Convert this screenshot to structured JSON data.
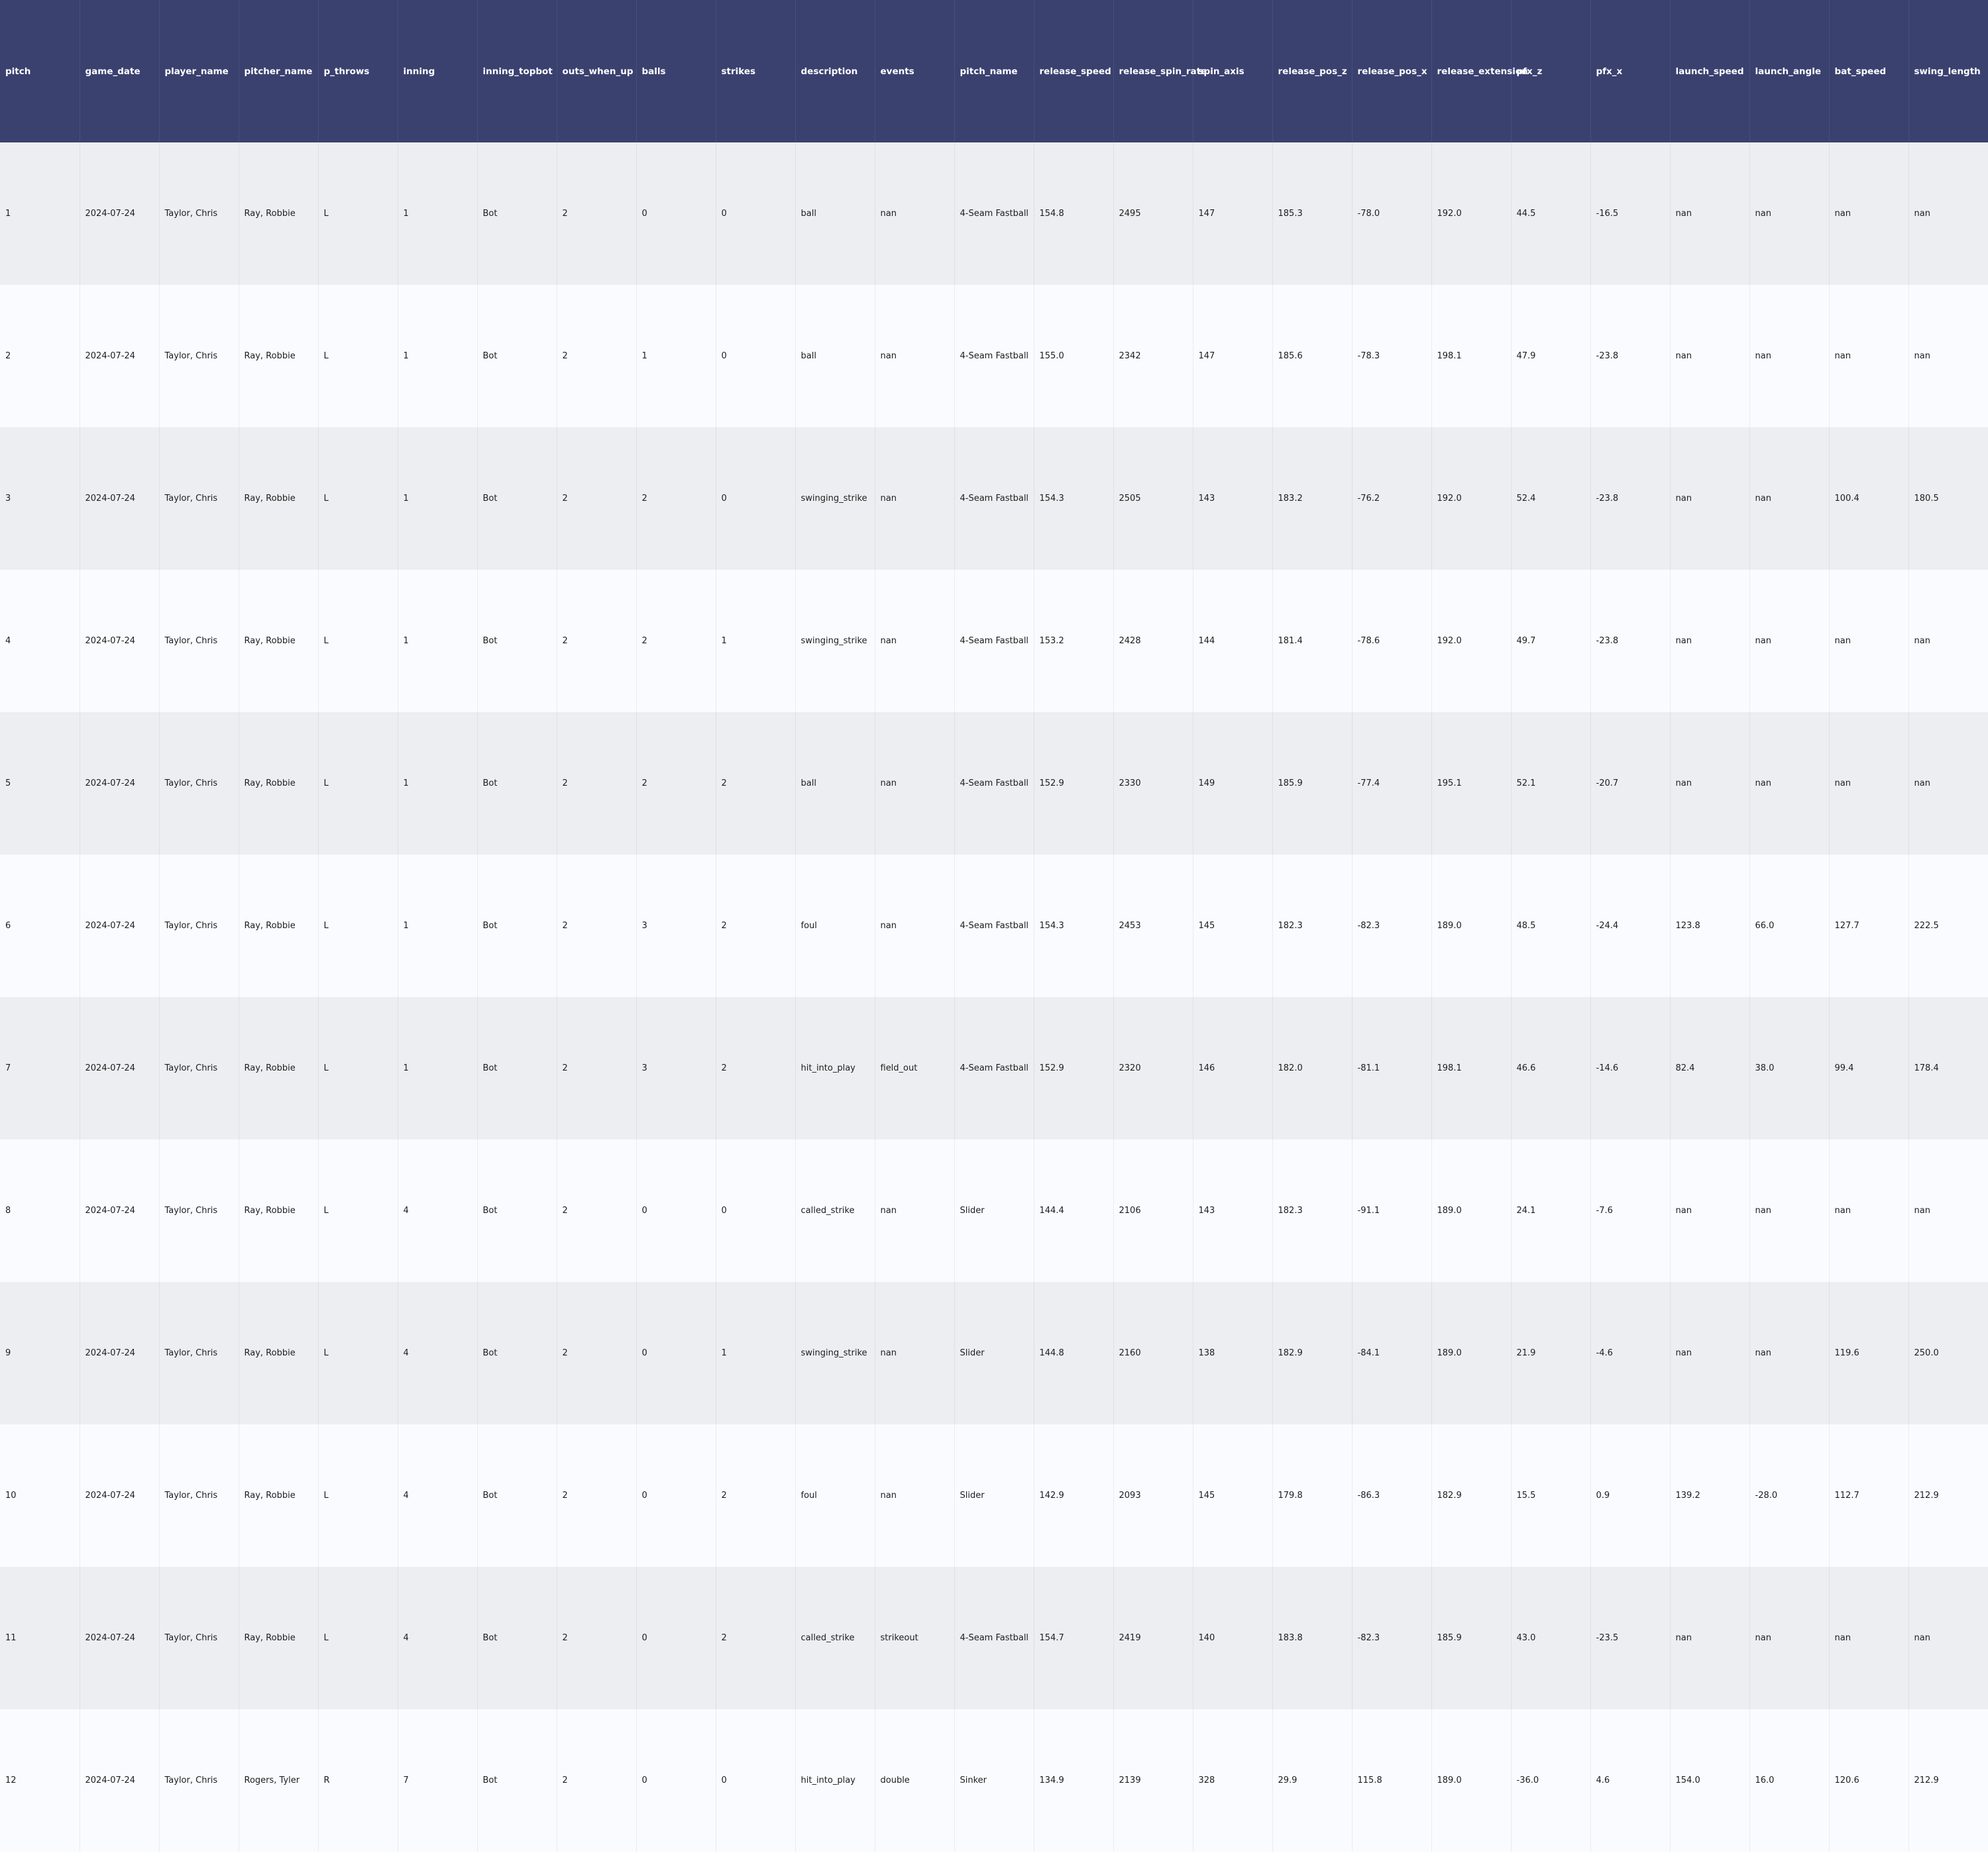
{
  "chart_data": {
    "type": "table",
    "columns": [
      "pitch",
      "game_date",
      "player_name",
      "pitcher_name",
      "p_throws",
      "inning",
      "inning_topbot",
      "outs_when_up",
      "balls",
      "strikes",
      "description",
      "events",
      "pitch_name",
      "release_speed",
      "release_spin_rate",
      "spin_axis",
      "release_pos_z",
      "release_pos_x",
      "release_extension",
      "pfx_z",
      "pfx_x",
      "launch_speed",
      "launch_angle",
      "bat_speed",
      "swing_length"
    ],
    "rows": [
      [
        "1",
        "2024-07-24",
        "Taylor, Chris",
        "Ray, Robbie",
        "L",
        "1",
        "Bot",
        "2",
        "0",
        "0",
        "ball",
        "nan",
        "4-Seam Fastball",
        "154.8",
        "2495",
        "147",
        "185.3",
        "-78.0",
        "192.0",
        "44.5",
        "-16.5",
        "nan",
        "nan",
        "nan",
        "nan"
      ],
      [
        "2",
        "2024-07-24",
        "Taylor, Chris",
        "Ray, Robbie",
        "L",
        "1",
        "Bot",
        "2",
        "1",
        "0",
        "ball",
        "nan",
        "4-Seam Fastball",
        "155.0",
        "2342",
        "147",
        "185.6",
        "-78.3",
        "198.1",
        "47.9",
        "-23.8",
        "nan",
        "nan",
        "nan",
        "nan"
      ],
      [
        "3",
        "2024-07-24",
        "Taylor, Chris",
        "Ray, Robbie",
        "L",
        "1",
        "Bot",
        "2",
        "2",
        "0",
        "swinging_strike",
        "nan",
        "4-Seam Fastball",
        "154.3",
        "2505",
        "143",
        "183.2",
        "-76.2",
        "192.0",
        "52.4",
        "-23.8",
        "nan",
        "nan",
        "100.4",
        "180.5"
      ],
      [
        "4",
        "2024-07-24",
        "Taylor, Chris",
        "Ray, Robbie",
        "L",
        "1",
        "Bot",
        "2",
        "2",
        "1",
        "swinging_strike",
        "nan",
        "4-Seam Fastball",
        "153.2",
        "2428",
        "144",
        "181.4",
        "-78.6",
        "192.0",
        "49.7",
        "-23.8",
        "nan",
        "nan",
        "nan",
        "nan"
      ],
      [
        "5",
        "2024-07-24",
        "Taylor, Chris",
        "Ray, Robbie",
        "L",
        "1",
        "Bot",
        "2",
        "2",
        "2",
        "ball",
        "nan",
        "4-Seam Fastball",
        "152.9",
        "2330",
        "149",
        "185.9",
        "-77.4",
        "195.1",
        "52.1",
        "-20.7",
        "nan",
        "nan",
        "nan",
        "nan"
      ],
      [
        "6",
        "2024-07-24",
        "Taylor, Chris",
        "Ray, Robbie",
        "L",
        "1",
        "Bot",
        "2",
        "3",
        "2",
        "foul",
        "nan",
        "4-Seam Fastball",
        "154.3",
        "2453",
        "145",
        "182.3",
        "-82.3",
        "189.0",
        "48.5",
        "-24.4",
        "123.8",
        "66.0",
        "127.7",
        "222.5"
      ],
      [
        "7",
        "2024-07-24",
        "Taylor, Chris",
        "Ray, Robbie",
        "L",
        "1",
        "Bot",
        "2",
        "3",
        "2",
        "hit_into_play",
        "field_out",
        "4-Seam Fastball",
        "152.9",
        "2320",
        "146",
        "182.0",
        "-81.1",
        "198.1",
        "46.6",
        "-14.6",
        "82.4",
        "38.0",
        "99.4",
        "178.4"
      ],
      [
        "8",
        "2024-07-24",
        "Taylor, Chris",
        "Ray, Robbie",
        "L",
        "4",
        "Bot",
        "2",
        "0",
        "0",
        "called_strike",
        "nan",
        "Slider",
        "144.4",
        "2106",
        "143",
        "182.3",
        "-91.1",
        "189.0",
        "24.1",
        "-7.6",
        "nan",
        "nan",
        "nan",
        "nan"
      ],
      [
        "9",
        "2024-07-24",
        "Taylor, Chris",
        "Ray, Robbie",
        "L",
        "4",
        "Bot",
        "2",
        "0",
        "1",
        "swinging_strike",
        "nan",
        "Slider",
        "144.8",
        "2160",
        "138",
        "182.9",
        "-84.1",
        "189.0",
        "21.9",
        "-4.6",
        "nan",
        "nan",
        "119.6",
        "250.0"
      ],
      [
        "10",
        "2024-07-24",
        "Taylor, Chris",
        "Ray, Robbie",
        "L",
        "4",
        "Bot",
        "2",
        "0",
        "2",
        "foul",
        "nan",
        "Slider",
        "142.9",
        "2093",
        "145",
        "179.8",
        "-86.3",
        "182.9",
        "15.5",
        "0.9",
        "139.2",
        "-28.0",
        "112.7",
        "212.9"
      ],
      [
        "11",
        "2024-07-24",
        "Taylor, Chris",
        "Ray, Robbie",
        "L",
        "4",
        "Bot",
        "2",
        "0",
        "2",
        "called_strike",
        "strikeout",
        "4-Seam Fastball",
        "154.7",
        "2419",
        "140",
        "183.8",
        "-82.3",
        "185.9",
        "43.0",
        "-23.5",
        "nan",
        "nan",
        "nan",
        "nan"
      ],
      [
        "12",
        "2024-07-24",
        "Taylor, Chris",
        "Rogers, Tyler",
        "R",
        "7",
        "Bot",
        "2",
        "0",
        "0",
        "hit_into_play",
        "double",
        "Sinker",
        "134.9",
        "2139",
        "328",
        "29.9",
        "115.8",
        "189.0",
        "-36.0",
        "4.6",
        "154.0",
        "16.0",
        "120.6",
        "212.9"
      ]
    ]
  }
}
